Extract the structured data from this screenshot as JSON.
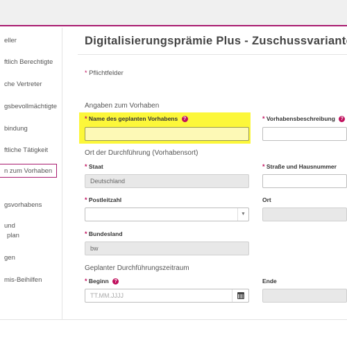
{
  "sidebar": {
    "items": [
      {
        "label": "eller"
      },
      {
        "label": "ftlich Berechtigte"
      },
      {
        "label": "che Vertreter"
      },
      {
        "label": "gsbevollmächtigte"
      },
      {
        "label": "bindung"
      },
      {
        "label": "ftliche Tätigkeit"
      },
      {
        "label": "n zum Vorhaben",
        "active": true
      },
      {
        "label": "gsvorhabens"
      },
      {
        "label_line1": "und",
        "label_line2": "plan"
      },
      {
        "label": "gen"
      },
      {
        "label": "mis-Beihilfen"
      }
    ]
  },
  "main": {
    "title": "Digitalisierungsprämie Plus - Zuschussvariante",
    "required_star": "*",
    "required_note": "Pflichtfelder",
    "sections": {
      "vorhaben": "Angaben zum Vorhaben",
      "ort": "Ort der Durchführung (Vorhabensort)",
      "zeitraum": "Geplanter Durchführungszeitraum"
    },
    "fields": {
      "name": {
        "label": "Name des geplanten Vorhabens",
        "value": "",
        "help": "?"
      },
      "beschreibung": {
        "label": "Vorhabensbeschreibung",
        "value": "",
        "help": "?"
      },
      "staat": {
        "label": "Staat",
        "value": "Deutschland"
      },
      "strasse": {
        "label": "Straße und Hausnummer",
        "value": ""
      },
      "plz": {
        "label": "Postleitzahl",
        "value": "",
        "arrow": "▼"
      },
      "ort": {
        "label": "Ort",
        "value": ""
      },
      "bundesland": {
        "label": "Bundesland",
        "value": "bw"
      },
      "beginn": {
        "label": "Beginn",
        "placeholder": "TT.MM.JJJJ",
        "help": "?"
      },
      "ende": {
        "label": "Ende",
        "value": ""
      }
    }
  },
  "colors": {
    "accent": "#a8196e",
    "required": "#c0105d",
    "highlight": "#fcf73a"
  },
  "icons": {
    "help": "question-circle-icon",
    "calendar": "calendar-icon",
    "dropdown": "chevron-down-icon"
  }
}
